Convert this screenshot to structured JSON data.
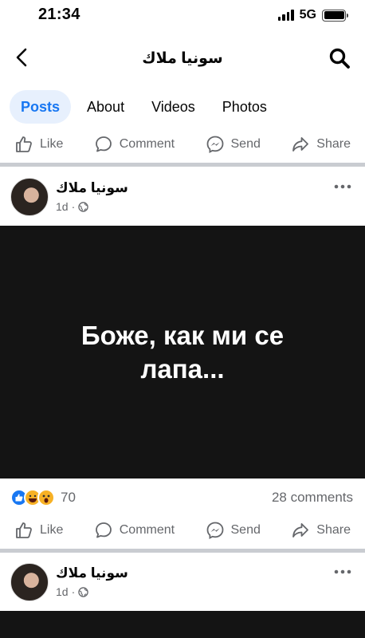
{
  "status": {
    "time": "21:34",
    "network": "5G"
  },
  "nav": {
    "title": "سونيا ملاك"
  },
  "tabs": [
    {
      "label": "Posts",
      "active": true
    },
    {
      "label": "About"
    },
    {
      "label": "Videos"
    },
    {
      "label": "Photos"
    }
  ],
  "actions": {
    "like": "Like",
    "comment": "Comment",
    "send": "Send",
    "share": "Share"
  },
  "posts": [
    {
      "author": "سونيا ملاك",
      "time": "1d",
      "text": "Боже, как ми се лапа...",
      "reaction_count": "70",
      "comments": "28 comments"
    },
    {
      "author": "سونيا ملاك",
      "time": "1d"
    }
  ],
  "colors": {
    "accent": "#1877f2",
    "tab_active_bg": "#e7f0fd",
    "muted": "#65676b",
    "media_bg": "#141414"
  }
}
